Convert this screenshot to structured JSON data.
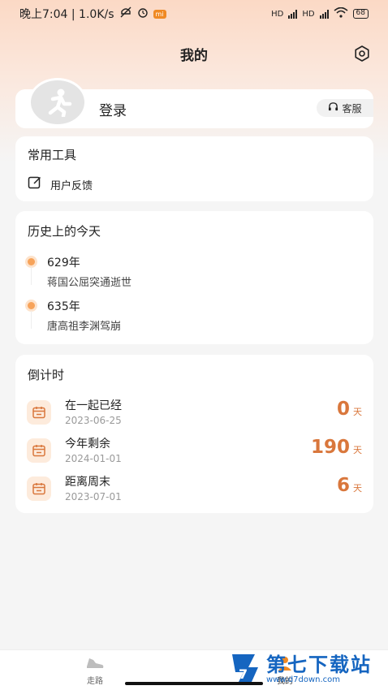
{
  "status_bar": {
    "time_speed": "晚上7:04 | 1.0K/s",
    "battery": "68",
    "signal_1": "HD",
    "signal_2": "HD"
  },
  "header": {
    "title": "我的"
  },
  "login": {
    "label": "登录",
    "service": "客服"
  },
  "tools": {
    "title": "常用工具",
    "feedback": "用户反馈"
  },
  "history": {
    "title": "历史上的今天",
    "items": [
      {
        "year": "629年",
        "desc": "蒋国公屈突通逝世"
      },
      {
        "year": "635年",
        "desc": "唐高祖李渊驾崩"
      }
    ]
  },
  "countdown": {
    "title": "倒计时",
    "items": [
      {
        "name": "在一起已经",
        "date": "2023-06-25",
        "value": "0",
        "unit": "天"
      },
      {
        "name": "今年剩余",
        "date": "2024-01-01",
        "value": "190",
        "unit": "天"
      },
      {
        "name": "距离周末",
        "date": "2023-07-01",
        "value": "6",
        "unit": "天"
      }
    ]
  },
  "tabbar": {
    "walk": "走路",
    "mine": "我的"
  },
  "watermark": {
    "title": "第七下载站",
    "url": "www.d7down.com"
  },
  "colors": {
    "accent": "#d9773c",
    "dot": "#f7a35a",
    "brand_blue": "#1565c0"
  }
}
